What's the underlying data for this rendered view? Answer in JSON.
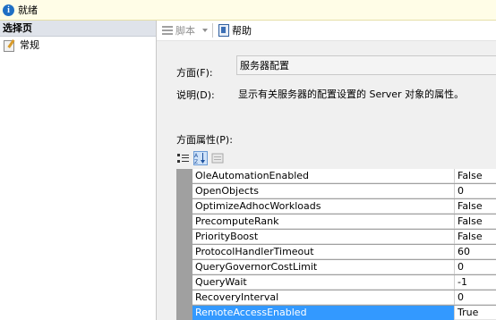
{
  "status": {
    "text": "就绪",
    "icon": "info-icon"
  },
  "left_pane": {
    "header": "选择页",
    "items": [
      {
        "label": "常规",
        "icon": "general-page-icon"
      }
    ]
  },
  "toolbar": {
    "script_label": "脚本",
    "help_label": "帮助"
  },
  "form": {
    "facet_label": "方面(F):",
    "facet_value": "服务器配置",
    "desc_label": "说明(D):",
    "desc_value": "显示有关服务器的配置设置的 Server 对象的属性。",
    "props_label": "方面属性(P):"
  },
  "properties": [
    {
      "name": "OleAutomationEnabled",
      "value": "False"
    },
    {
      "name": "OpenObjects",
      "value": "0"
    },
    {
      "name": "OptimizeAdhocWorkloads",
      "value": "False"
    },
    {
      "name": "PrecomputeRank",
      "value": "False"
    },
    {
      "name": "PriorityBoost",
      "value": "False"
    },
    {
      "name": "ProtocolHandlerTimeout",
      "value": "60"
    },
    {
      "name": "QueryGovernorCostLimit",
      "value": "0"
    },
    {
      "name": "QueryWait",
      "value": "-1"
    },
    {
      "name": "RecoveryInterval",
      "value": "0"
    },
    {
      "name": "RemoteAccessEnabled",
      "value": "True"
    }
  ],
  "selected_property": "RemoteAccessEnabled"
}
